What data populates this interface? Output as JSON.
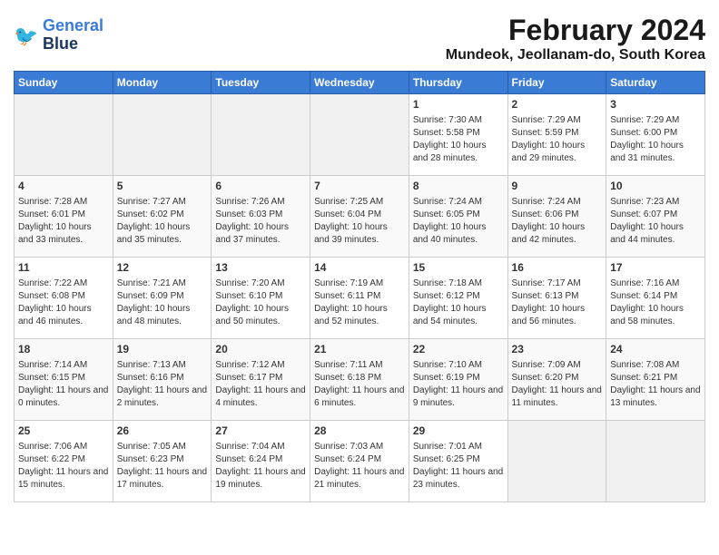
{
  "logo": {
    "line1": "General",
    "line2": "Blue"
  },
  "title": "February 2024",
  "subtitle": "Mundeok, Jeollanam-do, South Korea",
  "weekdays": [
    "Sunday",
    "Monday",
    "Tuesday",
    "Wednesday",
    "Thursday",
    "Friday",
    "Saturday"
  ],
  "weeks": [
    [
      {
        "day": "",
        "sunrise": "",
        "sunset": "",
        "daylight": ""
      },
      {
        "day": "",
        "sunrise": "",
        "sunset": "",
        "daylight": ""
      },
      {
        "day": "",
        "sunrise": "",
        "sunset": "",
        "daylight": ""
      },
      {
        "day": "",
        "sunrise": "",
        "sunset": "",
        "daylight": ""
      },
      {
        "day": "1",
        "sunrise": "Sunrise: 7:30 AM",
        "sunset": "Sunset: 5:58 PM",
        "daylight": "Daylight: 10 hours and 28 minutes."
      },
      {
        "day": "2",
        "sunrise": "Sunrise: 7:29 AM",
        "sunset": "Sunset: 5:59 PM",
        "daylight": "Daylight: 10 hours and 29 minutes."
      },
      {
        "day": "3",
        "sunrise": "Sunrise: 7:29 AM",
        "sunset": "Sunset: 6:00 PM",
        "daylight": "Daylight: 10 hours and 31 minutes."
      }
    ],
    [
      {
        "day": "4",
        "sunrise": "Sunrise: 7:28 AM",
        "sunset": "Sunset: 6:01 PM",
        "daylight": "Daylight: 10 hours and 33 minutes."
      },
      {
        "day": "5",
        "sunrise": "Sunrise: 7:27 AM",
        "sunset": "Sunset: 6:02 PM",
        "daylight": "Daylight: 10 hours and 35 minutes."
      },
      {
        "day": "6",
        "sunrise": "Sunrise: 7:26 AM",
        "sunset": "Sunset: 6:03 PM",
        "daylight": "Daylight: 10 hours and 37 minutes."
      },
      {
        "day": "7",
        "sunrise": "Sunrise: 7:25 AM",
        "sunset": "Sunset: 6:04 PM",
        "daylight": "Daylight: 10 hours and 39 minutes."
      },
      {
        "day": "8",
        "sunrise": "Sunrise: 7:24 AM",
        "sunset": "Sunset: 6:05 PM",
        "daylight": "Daylight: 10 hours and 40 minutes."
      },
      {
        "day": "9",
        "sunrise": "Sunrise: 7:24 AM",
        "sunset": "Sunset: 6:06 PM",
        "daylight": "Daylight: 10 hours and 42 minutes."
      },
      {
        "day": "10",
        "sunrise": "Sunrise: 7:23 AM",
        "sunset": "Sunset: 6:07 PM",
        "daylight": "Daylight: 10 hours and 44 minutes."
      }
    ],
    [
      {
        "day": "11",
        "sunrise": "Sunrise: 7:22 AM",
        "sunset": "Sunset: 6:08 PM",
        "daylight": "Daylight: 10 hours and 46 minutes."
      },
      {
        "day": "12",
        "sunrise": "Sunrise: 7:21 AM",
        "sunset": "Sunset: 6:09 PM",
        "daylight": "Daylight: 10 hours and 48 minutes."
      },
      {
        "day": "13",
        "sunrise": "Sunrise: 7:20 AM",
        "sunset": "Sunset: 6:10 PM",
        "daylight": "Daylight: 10 hours and 50 minutes."
      },
      {
        "day": "14",
        "sunrise": "Sunrise: 7:19 AM",
        "sunset": "Sunset: 6:11 PM",
        "daylight": "Daylight: 10 hours and 52 minutes."
      },
      {
        "day": "15",
        "sunrise": "Sunrise: 7:18 AM",
        "sunset": "Sunset: 6:12 PM",
        "daylight": "Daylight: 10 hours and 54 minutes."
      },
      {
        "day": "16",
        "sunrise": "Sunrise: 7:17 AM",
        "sunset": "Sunset: 6:13 PM",
        "daylight": "Daylight: 10 hours and 56 minutes."
      },
      {
        "day": "17",
        "sunrise": "Sunrise: 7:16 AM",
        "sunset": "Sunset: 6:14 PM",
        "daylight": "Daylight: 10 hours and 58 minutes."
      }
    ],
    [
      {
        "day": "18",
        "sunrise": "Sunrise: 7:14 AM",
        "sunset": "Sunset: 6:15 PM",
        "daylight": "Daylight: 11 hours and 0 minutes."
      },
      {
        "day": "19",
        "sunrise": "Sunrise: 7:13 AM",
        "sunset": "Sunset: 6:16 PM",
        "daylight": "Daylight: 11 hours and 2 minutes."
      },
      {
        "day": "20",
        "sunrise": "Sunrise: 7:12 AM",
        "sunset": "Sunset: 6:17 PM",
        "daylight": "Daylight: 11 hours and 4 minutes."
      },
      {
        "day": "21",
        "sunrise": "Sunrise: 7:11 AM",
        "sunset": "Sunset: 6:18 PM",
        "daylight": "Daylight: 11 hours and 6 minutes."
      },
      {
        "day": "22",
        "sunrise": "Sunrise: 7:10 AM",
        "sunset": "Sunset: 6:19 PM",
        "daylight": "Daylight: 11 hours and 9 minutes."
      },
      {
        "day": "23",
        "sunrise": "Sunrise: 7:09 AM",
        "sunset": "Sunset: 6:20 PM",
        "daylight": "Daylight: 11 hours and 11 minutes."
      },
      {
        "day": "24",
        "sunrise": "Sunrise: 7:08 AM",
        "sunset": "Sunset: 6:21 PM",
        "daylight": "Daylight: 11 hours and 13 minutes."
      }
    ],
    [
      {
        "day": "25",
        "sunrise": "Sunrise: 7:06 AM",
        "sunset": "Sunset: 6:22 PM",
        "daylight": "Daylight: 11 hours and 15 minutes."
      },
      {
        "day": "26",
        "sunrise": "Sunrise: 7:05 AM",
        "sunset": "Sunset: 6:23 PM",
        "daylight": "Daylight: 11 hours and 17 minutes."
      },
      {
        "day": "27",
        "sunrise": "Sunrise: 7:04 AM",
        "sunset": "Sunset: 6:24 PM",
        "daylight": "Daylight: 11 hours and 19 minutes."
      },
      {
        "day": "28",
        "sunrise": "Sunrise: 7:03 AM",
        "sunset": "Sunset: 6:24 PM",
        "daylight": "Daylight: 11 hours and 21 minutes."
      },
      {
        "day": "29",
        "sunrise": "Sunrise: 7:01 AM",
        "sunset": "Sunset: 6:25 PM",
        "daylight": "Daylight: 11 hours and 23 minutes."
      },
      {
        "day": "",
        "sunrise": "",
        "sunset": "",
        "daylight": ""
      },
      {
        "day": "",
        "sunrise": "",
        "sunset": "",
        "daylight": ""
      }
    ]
  ]
}
